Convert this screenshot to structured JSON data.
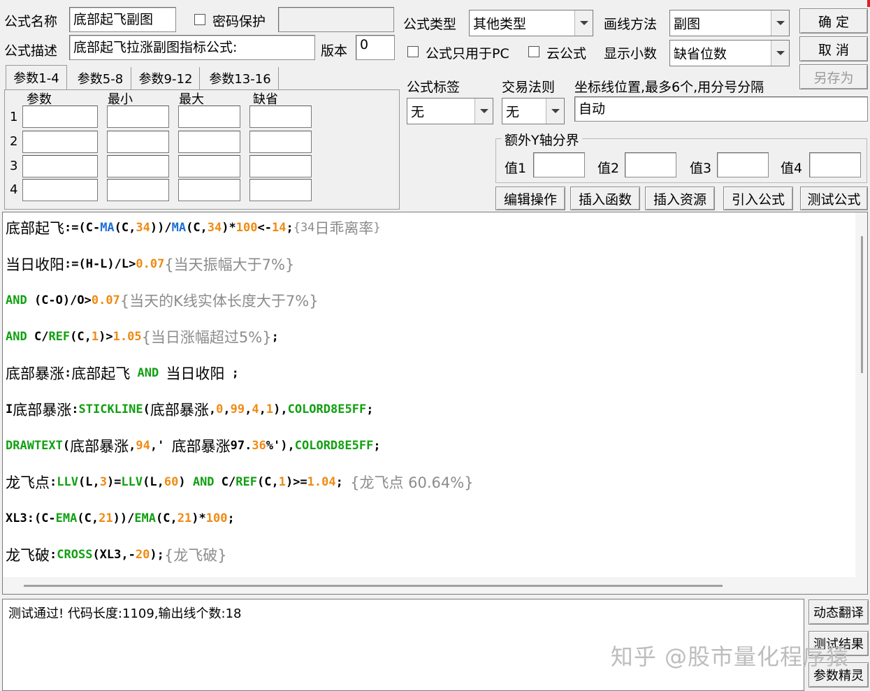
{
  "header": {
    "name_label": "公式名称",
    "name_value": "底部起飞副图",
    "password_label": "密码保护",
    "desc_label": "公式描述",
    "desc_value": "底部起飞拉涨副图指标公式:",
    "version_label": "版本",
    "version_value": "0",
    "type_label": "公式类型",
    "type_value": "其他类型",
    "draw_label": "画线方法",
    "draw_value": "副图",
    "pc_only_label": "公式只用于PC",
    "cloud_label": "云公式",
    "decimals_label": "显示小数",
    "decimals_value": "缺省位数"
  },
  "buttons": {
    "ok": "确  定",
    "cancel": "取  消",
    "save_as": "另存为",
    "edit_ops": "编辑操作",
    "insert_func": "插入函数",
    "insert_res": "插入资源",
    "import_formula": "引入公式",
    "test_formula": "测试公式",
    "dyn_translate": "动态翻译",
    "test_result": "测试结果",
    "param_wizard": "参数精灵"
  },
  "params": {
    "tabs": [
      "参数1-4",
      "参数5-8",
      "参数9-12",
      "参数13-16"
    ],
    "columns": [
      "参数",
      "最小",
      "最大",
      "缺省"
    ],
    "rows": [
      "1",
      "2",
      "3",
      "4"
    ]
  },
  "labels_section": {
    "tag_label": "公式标签",
    "tag_value": "无",
    "rule_label": "交易法则",
    "rule_value": "无",
    "axis_label": "坐标线位置,最多6个,用分号分隔",
    "axis_value": "自动",
    "extra_y_title": "额外Y轴分界",
    "v1": "值1",
    "v2": "值2",
    "v3": "值3",
    "v4": "值4"
  },
  "code": {
    "l1": {
      "a": "底部起飞",
      "b": ":=(C-",
      "c": "MA",
      "d": "(C,",
      "e": "34",
      "f": "))/",
      "g": "MA",
      "h": "(C,",
      "i": "34",
      "j": ")*",
      "k": "100",
      "l": "<-",
      "m": "14",
      "n": ";",
      "o": "{34",
      "p": "日乖离率",
      "q": "}"
    },
    "l2": {
      "a": "当日收阳",
      "b": ":=(H-L)/L>",
      "c": "0.07",
      "d": "{当天振幅大于7%}"
    },
    "l3": {
      "a": "AND",
      "b": " (C-O)/O>",
      "c": "0.07",
      "d": "{当天的K线实体长度大于7%}"
    },
    "l4": {
      "a": "AND",
      "b": " C/",
      "c": "REF",
      "d": "(C,",
      "e": "1",
      "f": ")>",
      "g": "1.05",
      "h": "{当日涨幅超过5%}",
      "i": ";"
    },
    "l5": {
      "a": "底部暴涨",
      "b": ":",
      "c": "底部起飞",
      "d": " AND ",
      "e": "当日收阳",
      "f": " ;"
    },
    "l6": {
      "a": "I",
      "b": "底部暴涨",
      "c": ":",
      "d": "STICKLINE",
      "e": "(",
      "f": "底部暴涨",
      "g": ",",
      "h": "0",
      "i": ",",
      "j": "99",
      "k": ",",
      "l": "4",
      "m": ",",
      "n": "1",
      "o": "),",
      "p": "COLORD8E5FF",
      "q": ";"
    },
    "l7": {
      "a": "DRAWTEXT",
      "b": "(",
      "c": "底部暴涨",
      "d": ",",
      "e": "94",
      "f": ",' ",
      "g": "底部暴涨",
      "h": "97.",
      "i": "36",
      "j": "%'),",
      "k": "COLORD8E5FF",
      "l": ";"
    },
    "l8": {
      "a": "龙飞点",
      "b": ":",
      "c": "LLV",
      "d": "(L,",
      "e": "3",
      "f": ")=",
      "g": "LLV",
      "h": "(L,",
      "i": "60",
      "j": ") ",
      "k": "AND",
      "l": " C/",
      "m": "REF",
      "n": "(C,",
      "o": "1",
      "p": ")>=",
      "q": "1.04",
      "r": "; ",
      "s": "{龙飞点 60.64%}"
    },
    "l9": {
      "a": "XL3",
      "b": ":(C-",
      "c": "EMA",
      "d": "(C,",
      "e": "21",
      "f": "))/",
      "g": "EMA",
      "h": "(C,",
      "i": "21",
      "j": ")*",
      "k": "100",
      "l": ";"
    },
    "l10": {
      "a": "龙飞破",
      "b": ":",
      "c": "CROSS",
      "d": "(XL3,-",
      "e": "20",
      "f": ");",
      "g": "{龙飞破}"
    }
  },
  "output": {
    "message": "测试通过! 代码长度:1109,输出线个数:18"
  },
  "watermark": "知乎 @股市量化程序猿"
}
